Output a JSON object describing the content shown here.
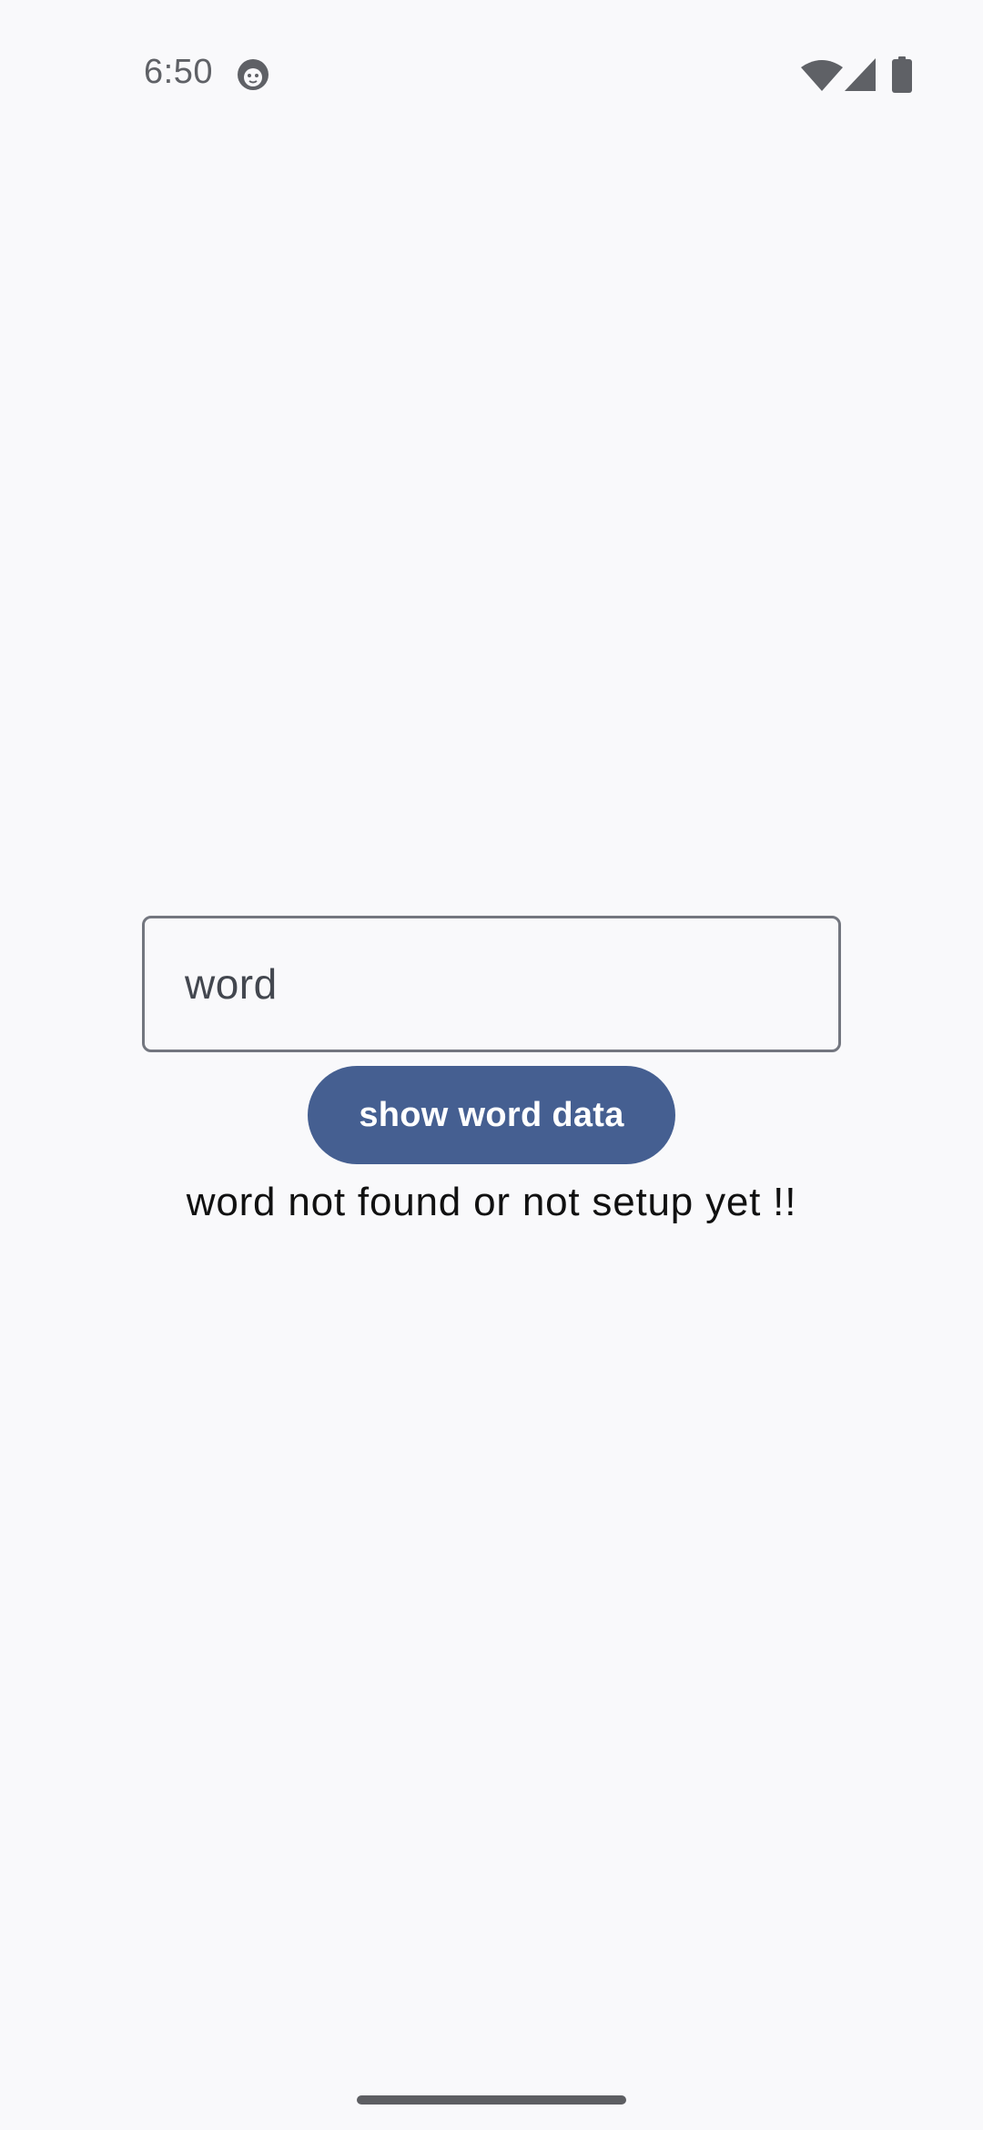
{
  "status_bar": {
    "time": "6:50",
    "icons": [
      "face-icon",
      "wifi-icon",
      "signal-icon",
      "battery-icon"
    ]
  },
  "main": {
    "input_value": "word",
    "button_label": "show word data",
    "result_message": "word not found or not setup yet !!"
  },
  "colors": {
    "background": "#f9f9fb",
    "button": "#455f91",
    "field_border": "#73767f"
  }
}
